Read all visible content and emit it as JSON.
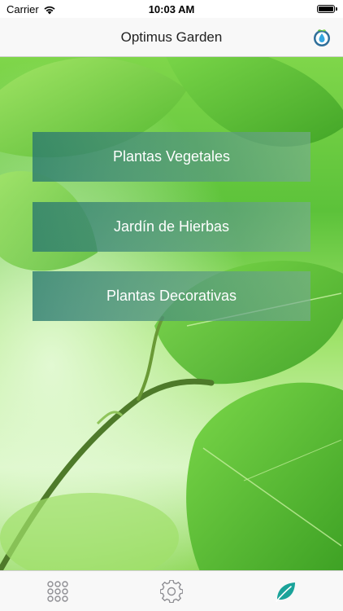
{
  "status_bar": {
    "carrier": "Carrier",
    "time": "10:03 AM"
  },
  "nav": {
    "title": "Optimus Garden",
    "logo_icon": "water-drop-leaf-logo"
  },
  "menu": {
    "items": [
      {
        "label": "Plantas Vegetales"
      },
      {
        "label": "Jardín de Hierbas"
      },
      {
        "label": "Plantas Decorativas"
      }
    ]
  },
  "tab_bar": {
    "tabs": [
      {
        "icon": "grid-dots-icon",
        "selected": false
      },
      {
        "icon": "gear-icon",
        "selected": false
      },
      {
        "icon": "leaf-icon",
        "selected": true
      }
    ],
    "accent_color": "#1aa39a",
    "inactive_color": "#8e8e93"
  }
}
